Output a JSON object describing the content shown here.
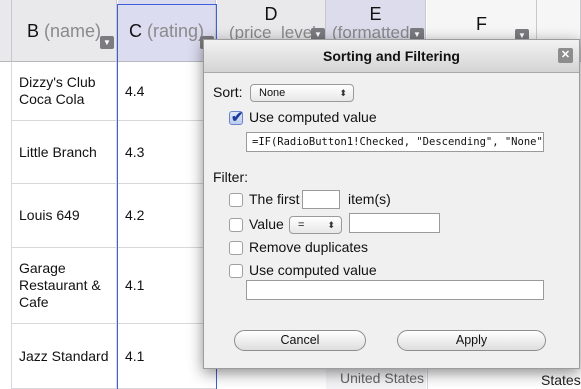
{
  "headers": {
    "b": {
      "letter": "B",
      "sub": "(name)"
    },
    "c": {
      "letter": "C",
      "sub": "(rating)"
    },
    "d": {
      "letter": "D",
      "sub": "(price_level"
    },
    "e": {
      "letter": "E",
      "sub": "(formatted"
    },
    "f": {
      "letter": "F"
    }
  },
  "rows": [
    {
      "name": "Dizzy's Club Coca Cola",
      "rating": "4.4"
    },
    {
      "name": "Little Branch",
      "rating": "4.3"
    },
    {
      "name": "Louis 649",
      "rating": "4.2"
    },
    {
      "name": "Garage Restaurant & Cafe",
      "rating": "4.1"
    },
    {
      "name": "Jazz Standard",
      "rating": "4.1"
    }
  ],
  "peek": {
    "e_bottom": "United States",
    "f_bottom": "States"
  },
  "dialog": {
    "title": "Sorting and Filtering",
    "close_glyph": "✕",
    "sort_label": "Sort:",
    "sort_value": "None",
    "use_computed_label": "Use computed value",
    "sort_formula": "=IF(RadioButton1!Checked, \"Descending\", \"None\")",
    "filter_label": "Filter:",
    "first_label": "The first",
    "first_value": "",
    "items_label": "item(s)",
    "value_label": "Value",
    "value_op": "=",
    "value_input": "",
    "remove_dup_label": "Remove duplicates",
    "filter_computed_label": "Use computed value",
    "filter_formula": "",
    "cancel_label": "Cancel",
    "apply_label": "Apply"
  }
}
